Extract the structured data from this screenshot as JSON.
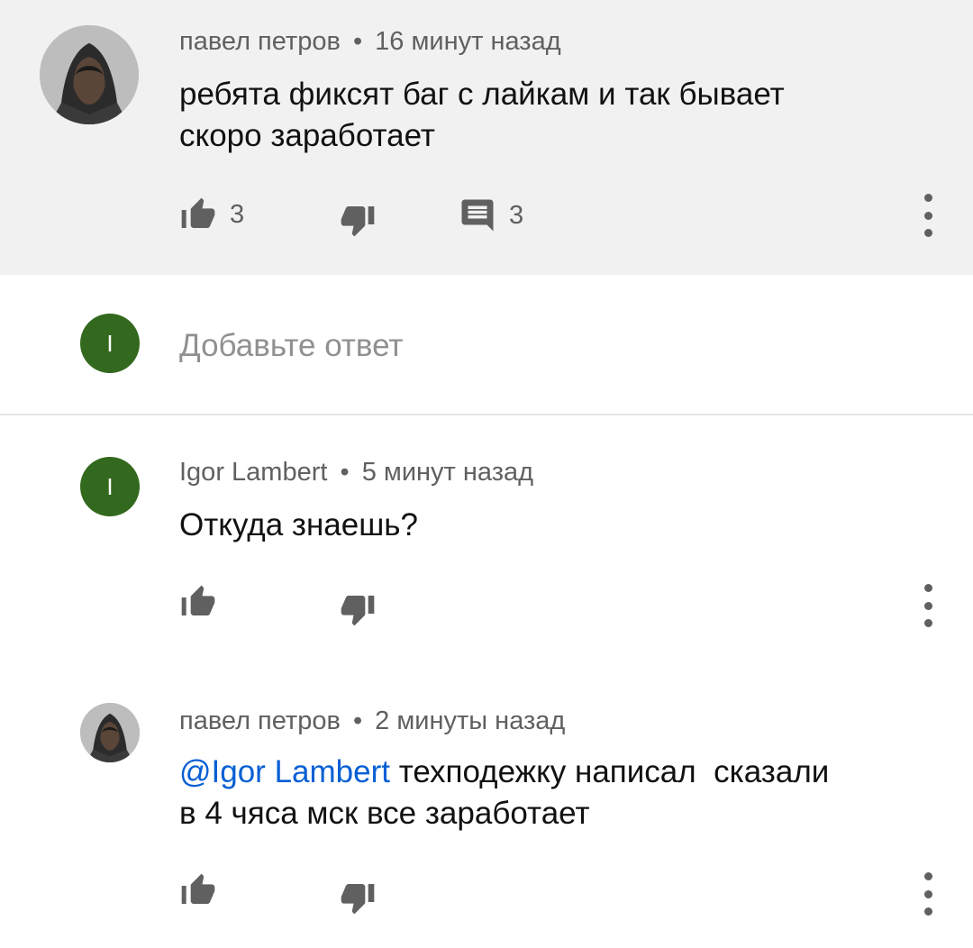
{
  "comments": [
    {
      "author": "павел петров",
      "separator": "•",
      "time": "16 минут назад",
      "line1": "ребята фиксят баг с лайкам и  так бывает",
      "line2": "скоро заработает",
      "likes": "3",
      "replies": "3"
    },
    {
      "avatar_letter": "I",
      "author": "Igor Lambert",
      "separator": "•",
      "time": "5 минут назад",
      "line1": "Откуда знаешь?"
    },
    {
      "author": "павел петров",
      "separator": "•",
      "time": "2 минуты назад",
      "mention": "@Igor Lambert",
      "line1_rest": " техподежку написал  сказали",
      "line2": "в 4 чяса мск все заработает"
    }
  ],
  "reply_box": {
    "avatar_letter": "I",
    "placeholder": "Добавьте ответ"
  },
  "icons": [
    "thumbs-up-icon",
    "thumbs-down-icon",
    "comment-icon",
    "more-vertical-icon"
  ],
  "colors": {
    "top_bg": "#f1f1f1",
    "avatar_green": "#33691e",
    "mention_blue": "#065fd4",
    "meta_gray": "#606060"
  }
}
